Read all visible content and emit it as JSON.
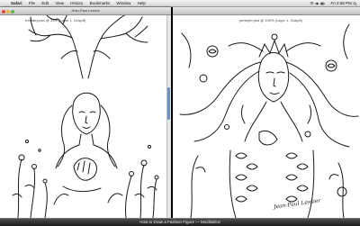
{
  "menubar": {
    "apple_glyph": "",
    "app_name": "Safari",
    "menus": [
      "File",
      "Edit",
      "View",
      "History",
      "Bookmarks",
      "Window",
      "Help"
    ],
    "clock": "Fri 2:58 PM"
  },
  "left_window": {
    "title": "Jean-Paul Lessier",
    "document_title": "treefairy.psd @ 33% (Layer 1, Gray/8)"
  },
  "right_window": {
    "document_title": "perseph.psd @ 100% (Layer 1, Gray/8)",
    "signature_text": "Jean-Paul Lessier"
  },
  "taskbar": {
    "title": "How to Draw a Fashion Figure — Mozilla/Ext"
  },
  "colors": {
    "menubar": "#e6e6e6",
    "canvas": "#ffffff",
    "ink": "#1a1a1a",
    "scroll_thumb": "#6e8fc4",
    "dock": "#2a2a2a"
  }
}
